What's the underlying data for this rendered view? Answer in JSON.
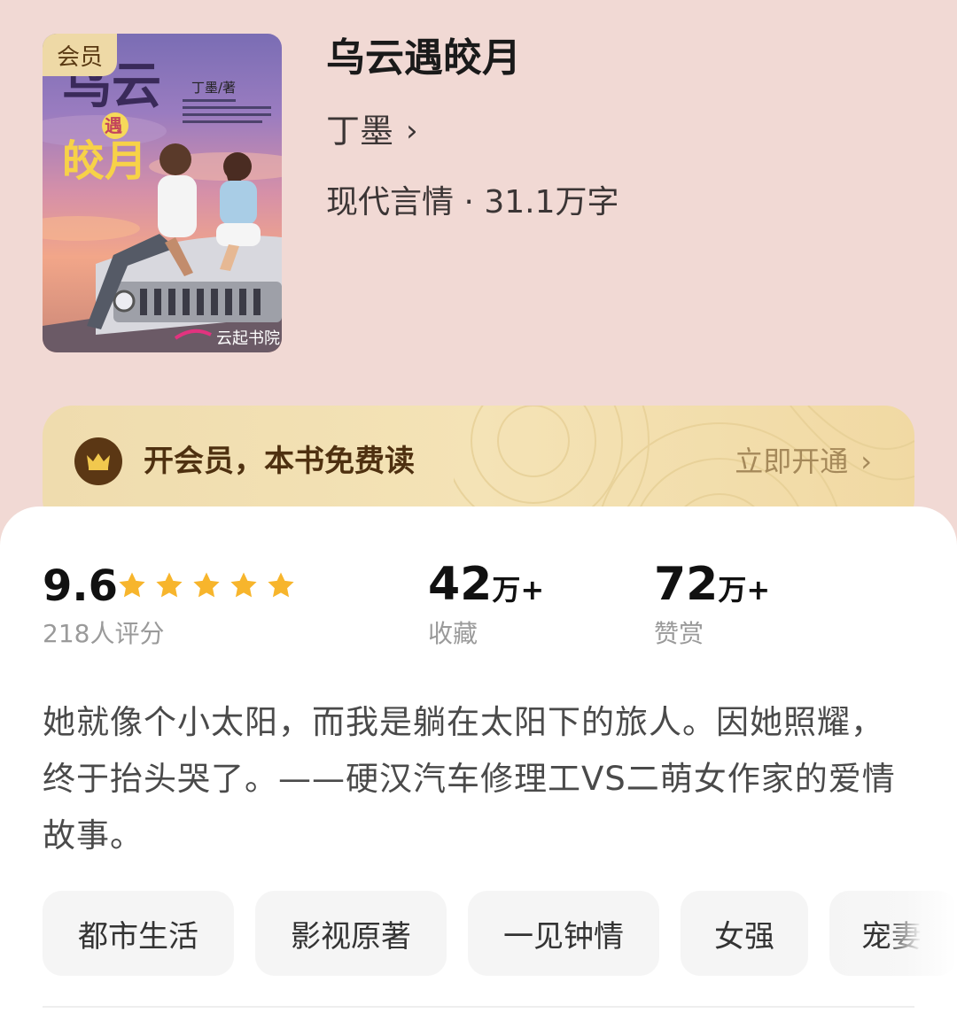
{
  "book": {
    "cover_badge": "会员",
    "cover_text": {
      "title_line1": "乌云",
      "title_char": "遇",
      "title_line2": "皎月",
      "author": "丁墨/著",
      "publisher": "云起书院"
    },
    "title": "乌云遇皎月",
    "author": "丁墨",
    "meta": "现代言情 · 31.1万字"
  },
  "vip_banner": {
    "text": "开会员，本书免费读",
    "action": "立即开通"
  },
  "stats": {
    "rating": {
      "score": "9.6",
      "stars": 5,
      "count_label": "218人评分"
    },
    "favorites": {
      "number": "42",
      "unit": "万+",
      "label": "收藏"
    },
    "rewards": {
      "number": "72",
      "unit": "万+",
      "label": "赞赏"
    }
  },
  "synopsis": "她就像个小太阳，而我是躺在太阳下的旅人。因她照耀，终于抬头哭了。——硬汉汽车修理工VS二萌女作家的爱情故事。",
  "tags": [
    "都市生活",
    "影视原著",
    "一见钟情",
    "女强",
    "宠妻"
  ],
  "colors": {
    "page_bg": "#f1d9d4",
    "star": "#f7b52c",
    "banner_text": "#4e3010",
    "banner_action": "#a5895a",
    "crown_bg": "#5b3714"
  }
}
